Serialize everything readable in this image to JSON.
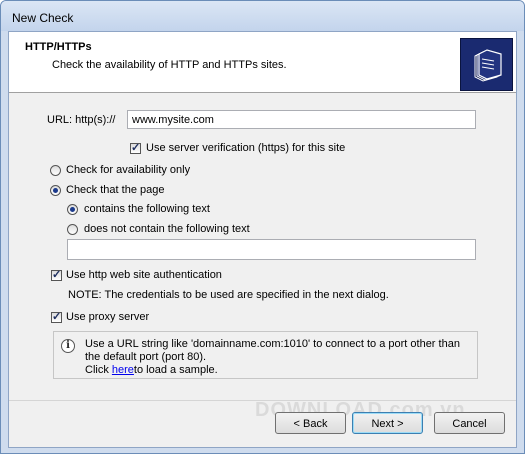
{
  "window": {
    "title": "New Check"
  },
  "header": {
    "title": "HTTP/HTTPs",
    "subtitle": "Check the availability of HTTP and HTTPs sites.",
    "icon": "folder-stack-icon"
  },
  "form": {
    "url_label": "URL: http(s)://",
    "url_value": "www.mysite.com",
    "server_verification": {
      "label": "Use server verification (https) for this site",
      "checked": true
    },
    "check_mode": {
      "availability_only": {
        "label": "Check for availability only",
        "selected": false
      },
      "check_page": {
        "label": "Check that the page",
        "selected": true
      }
    },
    "text_mode": {
      "contains": {
        "label": "contains the following text",
        "selected": true
      },
      "not_contains": {
        "label": "does not contain the following text",
        "selected": false
      }
    },
    "text_value": "",
    "auth": {
      "label": "Use http web site authentication",
      "checked": true
    },
    "auth_note": "NOTE: The credentials to be used are specified in the next dialog.",
    "proxy": {
      "label": "Use proxy server",
      "checked": true
    }
  },
  "info": {
    "icon": "info-icon",
    "line1": "Use a URL string like 'domainname.com:1010' to connect to a port other than",
    "line2": "the default port (port 80).",
    "line3_prefix": "Click ",
    "link_text": "here",
    "line3_suffix": "to load a sample."
  },
  "watermark": "DOWNLOAD.com.vn",
  "buttons": {
    "back": "< Back",
    "next": "Next >",
    "cancel": "Cancel"
  }
}
